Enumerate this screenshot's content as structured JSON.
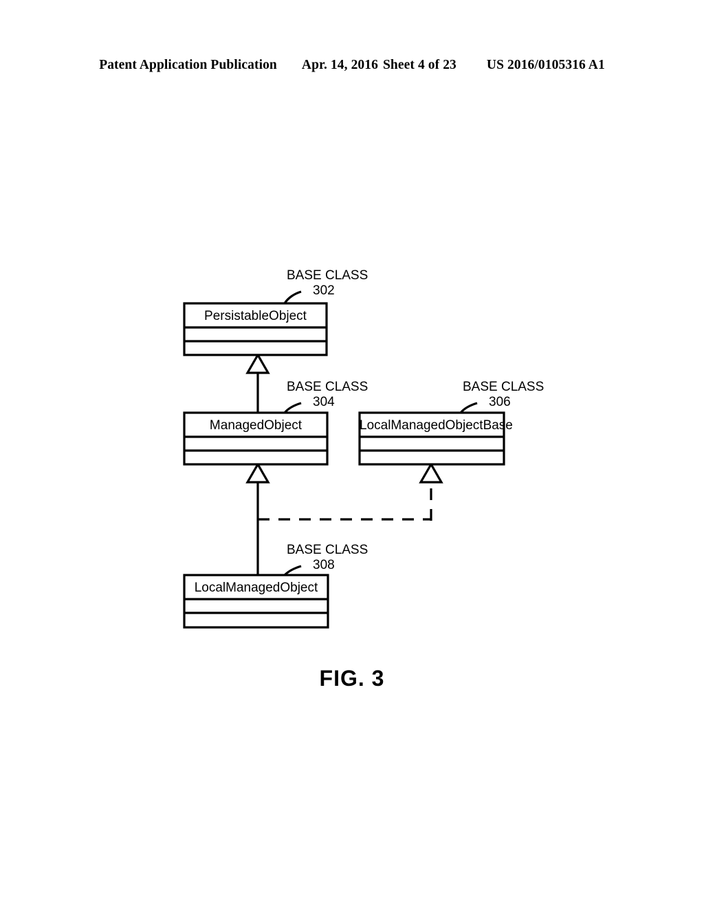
{
  "header": {
    "publication": "Patent Application Publication",
    "date": "Apr. 14, 2016",
    "sheet": "Sheet 4 of 23",
    "document_number": "US 2016/0105316 A1"
  },
  "figure": {
    "caption": "FIG. 3",
    "classes": [
      {
        "id": "persistable-object",
        "name": "PersistableObject",
        "annotation": "BASE CLASS",
        "reference_numeral": "302"
      },
      {
        "id": "managed-object",
        "name": "ManagedObject",
        "annotation": "BASE CLASS",
        "reference_numeral": "304"
      },
      {
        "id": "local-managed-object-base",
        "name": "LocalManagedObjectBase",
        "annotation": "BASE CLASS",
        "reference_numeral": "306"
      },
      {
        "id": "local-managed-object",
        "name": "LocalManagedObject",
        "annotation": "BASE CLASS",
        "reference_numeral": "308"
      }
    ],
    "connectors": [
      {
        "id": "managed-to-persistable",
        "style": "solid",
        "arrow": "hollow-triangle",
        "from": "ManagedObject",
        "to": "PersistableObject"
      },
      {
        "id": "local-to-managed",
        "style": "solid",
        "arrow": "hollow-triangle",
        "from": "LocalManagedObject",
        "to": "ManagedObject"
      },
      {
        "id": "local-to-localbase",
        "style": "dashed",
        "arrow": "hollow-triangle",
        "from": "LocalManagedObject",
        "to": "LocalManagedObjectBase"
      }
    ]
  }
}
